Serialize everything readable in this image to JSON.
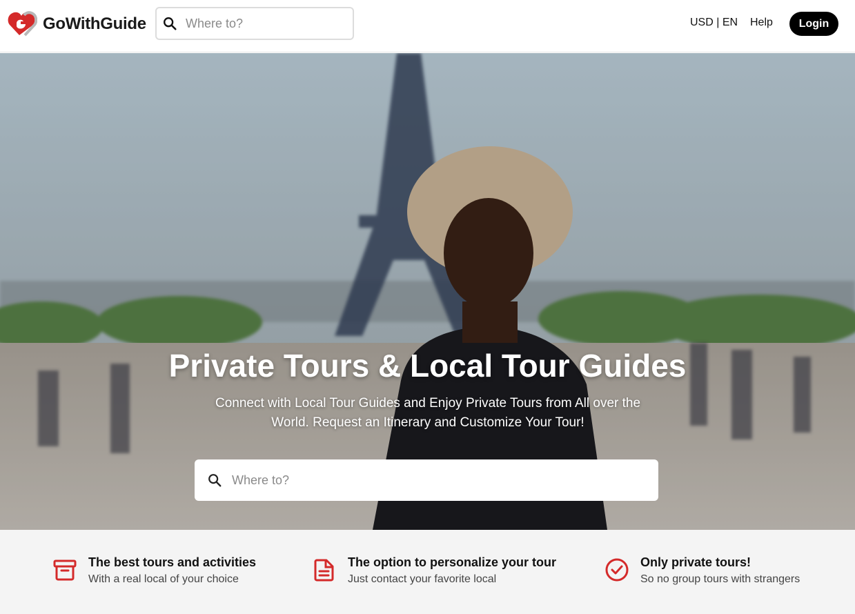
{
  "brand": {
    "name": "GoWithGuide",
    "accent": "#d42a2a"
  },
  "header": {
    "search_placeholder": "Where to?",
    "currency_lang": "USD | EN",
    "help": "Help",
    "login": "Login"
  },
  "hero": {
    "title": "Private Tours & Local Tour Guides",
    "subtitle": "Connect with Local Tour Guides and Enjoy Private Tours from All over the World. Request an Itinerary and Customize Your Tour!",
    "search_placeholder": "Where to?"
  },
  "features": [
    {
      "icon": "archive-box-icon",
      "title": "The best tours and activities",
      "subtitle": "With a real local of your choice"
    },
    {
      "icon": "document-icon",
      "title": "The option to personalize your tour",
      "subtitle": "Just contact your favorite local"
    },
    {
      "icon": "check-circle-icon",
      "title": "Only private tours!",
      "subtitle": "So no group tours with strangers"
    }
  ]
}
